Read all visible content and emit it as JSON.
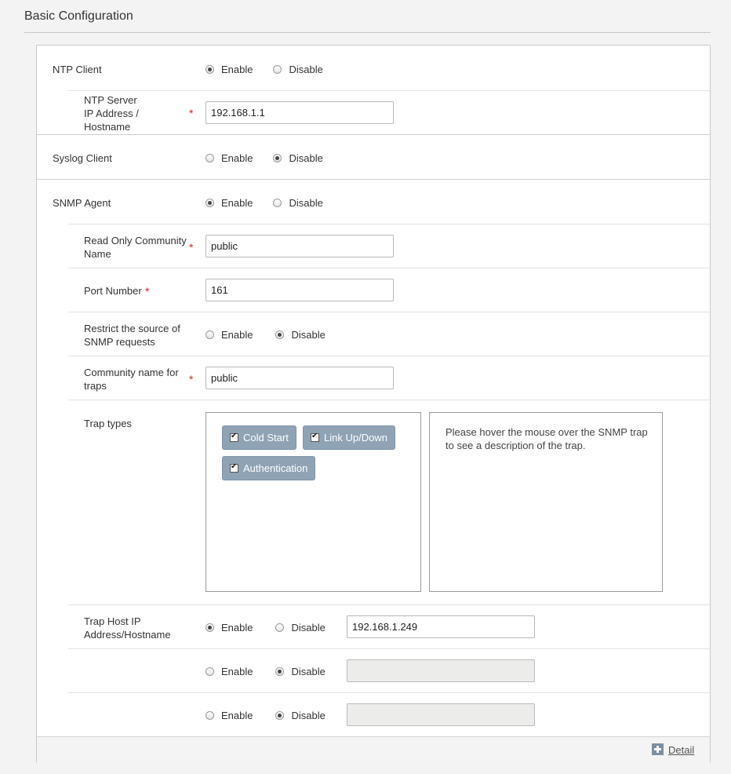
{
  "section": {
    "title": "Basic Configuration"
  },
  "radio": {
    "enable": "Enable",
    "disable": "Disable"
  },
  "ntp": {
    "client_label": "NTP Client",
    "client_state": "Enable",
    "server_label": "NTP Server\nIP Address /\nHostname",
    "server_value": "192.168.1.1"
  },
  "syslog": {
    "label": "Syslog Client",
    "state": "Disable"
  },
  "snmp": {
    "label": "SNMP Agent",
    "state": "Enable",
    "ro_community_label": "Read Only Community\nName",
    "ro_community_value": "public",
    "port_label": "Port Number",
    "port_value": "161",
    "restrict_label": "Restrict the source of\nSNMP requests",
    "restrict_state": "Disable",
    "trap_community_label": "Community name for\ntraps",
    "trap_community_value": "public",
    "trap_types_label": "Trap types",
    "trap_types": [
      "Cold Start",
      "Link Up/Down",
      "Authentication"
    ],
    "trap_description": "Please hover the mouse over the SNMP trap\nto see a description of the trap.",
    "trap_host_label": "Trap Host IP\nAddress/Hostname",
    "trap_hosts": [
      {
        "state": "Enable",
        "value": "192.168.1.249",
        "disabled": false
      },
      {
        "state": "Disable",
        "value": "",
        "disabled": true
      },
      {
        "state": "Disable",
        "value": "",
        "disabled": true
      }
    ]
  },
  "required_marker": "*",
  "footer": {
    "detail_label": "Detail",
    "icon": "plus-icon"
  }
}
